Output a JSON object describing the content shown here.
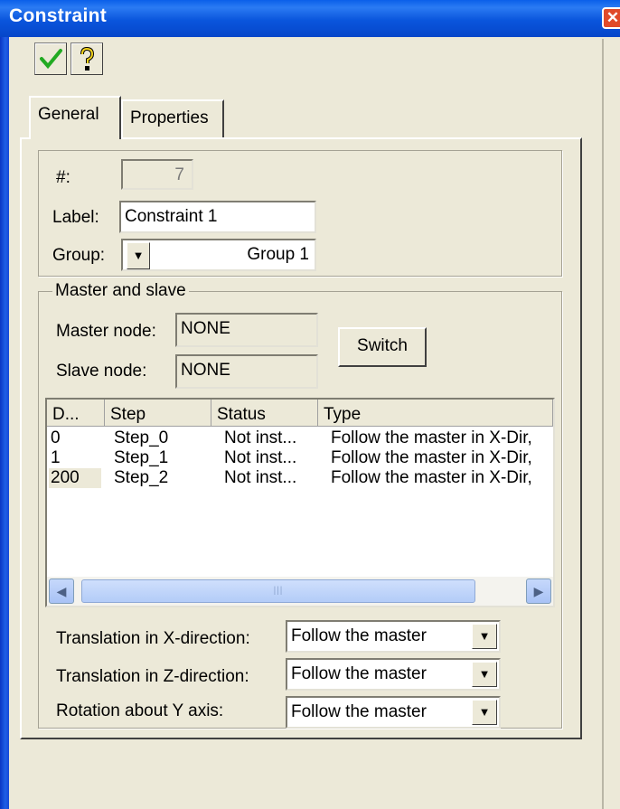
{
  "window": {
    "title": "Constraint",
    "close_glyph": "✕"
  },
  "toolbar": {
    "ok_icon": "check-icon",
    "help_icon": "help-icon"
  },
  "tabs": [
    {
      "label": "General"
    },
    {
      "label": "Properties"
    }
  ],
  "general": {
    "number_label": "#:",
    "number_value": "7",
    "label_label": "Label:",
    "label_value": "Constraint 1",
    "group_label": "Group:",
    "group_value": "Group 1"
  },
  "master_slave": {
    "legend": "Master and slave",
    "master_label": "Master node:",
    "master_value": "NONE",
    "slave_label": "Slave node:",
    "slave_value": "NONE",
    "switch_label": "Switch"
  },
  "table": {
    "columns": [
      "D...",
      "Step",
      "Status",
      "Type"
    ],
    "rows": [
      [
        "0",
        "Step_0",
        "Not inst...",
        "Follow the master in X-Dir,"
      ],
      [
        "1",
        "Step_1",
        "Not inst...",
        "Follow the master in X-Dir,"
      ],
      [
        "200",
        "Step_2",
        "Not inst...",
        "Follow the master in X-Dir,"
      ]
    ]
  },
  "dofs": [
    {
      "label": "Translation in X-direction:",
      "value": "Follow the master"
    },
    {
      "label": "Translation in Z-direction:",
      "value": "Follow the master"
    },
    {
      "label": "Rotation about Y axis:",
      "value": "Follow the master"
    }
  ],
  "colors": {
    "titlebar": "#0a55dc",
    "dialog_bg": "#ece9d8",
    "ok_check": "#22aa22"
  }
}
